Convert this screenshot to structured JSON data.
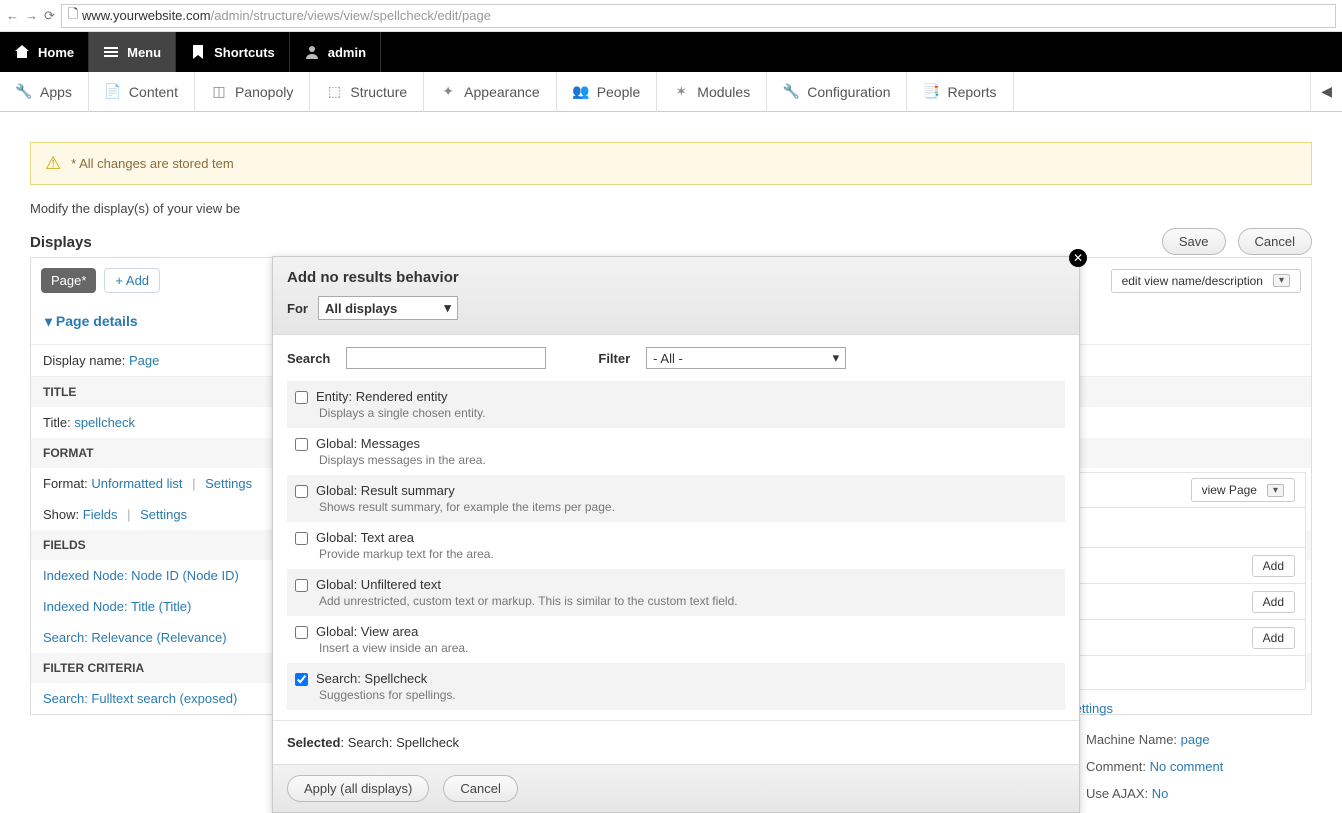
{
  "browser": {
    "url_prefix": "www.yourwebsite.com",
    "url_path": "/admin/structure/views/view/spellcheck/edit/page"
  },
  "toolbar_black": {
    "home": "Home",
    "menu": "Menu",
    "shortcuts": "Shortcuts",
    "user": "admin"
  },
  "toolbar_white": {
    "apps": "Apps",
    "content": "Content",
    "panopoly": "Panopoly",
    "structure": "Structure",
    "appearance": "Appearance",
    "people": "People",
    "modules": "Modules",
    "configuration": "Configuration",
    "reports": "Reports"
  },
  "notice": "* All changes are stored tem",
  "intro": "Modify the display(s) of your view be",
  "buttons": {
    "save": "Save",
    "cancel": "Cancel"
  },
  "displays": {
    "heading": "Displays",
    "page_tab": "Page*",
    "add": "+ Add",
    "edit_view": "edit view name/description",
    "page_details": "Page details",
    "display_name_label": "Display name:",
    "display_name_value": "Page"
  },
  "left": {
    "title_section": "TITLE",
    "title_label": "Title:",
    "title_value": "spellcheck",
    "format_section": "FORMAT",
    "format_label": "Format:",
    "format_value": "Unformatted list",
    "settings": "Settings",
    "show_label": "Show:",
    "show_value": "Fields",
    "settings2": "Settings",
    "fields_section": "FIELDS",
    "field1": "Indexed Node: Node ID (Node ID)",
    "field2": "Indexed Node: Title (Title)",
    "field3": "Search: Relevance (Relevance)",
    "filter_section": "FILTER CRITERIA",
    "filter_add": "Add",
    "filter1": "Search: Fulltext search (exposed)"
  },
  "right": {
    "view_page": "view Page",
    "add": "Add",
    "settings_link": "Settings",
    "machine_label": "Machine Name:",
    "machine_value": "page",
    "comment_label": "Comment:",
    "comment_value": "No comment",
    "ajax_label": "Use AJAX:",
    "ajax_value": "No"
  },
  "modal": {
    "title": "Add no results behavior",
    "for_label": "For",
    "for_value": "All displays",
    "search_label": "Search",
    "filter_label": "Filter",
    "filter_value": "- All -",
    "options": [
      {
        "checked": false,
        "title": "Entity: Rendered entity",
        "desc": "Displays a single chosen entity."
      },
      {
        "checked": false,
        "title": "Global: Messages",
        "desc": "Displays messages in the area."
      },
      {
        "checked": false,
        "title": "Global: Result summary",
        "desc": "Shows result summary, for example the items per page."
      },
      {
        "checked": false,
        "title": "Global: Text area",
        "desc": "Provide markup text for the area."
      },
      {
        "checked": false,
        "title": "Global: Unfiltered text",
        "desc": "Add unrestricted, custom text or markup. This is similar to the custom text field."
      },
      {
        "checked": false,
        "title": "Global: View area",
        "desc": "Insert a view inside an area."
      },
      {
        "checked": true,
        "title": "Search: Spellcheck",
        "desc": "Suggestions for spellings."
      }
    ],
    "selected_label": "Selected",
    "selected_value": "Search: Spellcheck",
    "apply": "Apply (all displays)",
    "cancel": "Cancel"
  }
}
